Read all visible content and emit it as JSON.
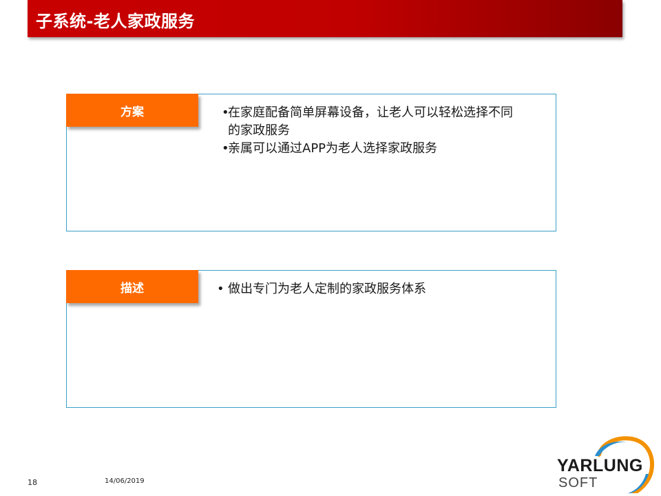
{
  "header": {
    "title": "子系统-老人家政服务"
  },
  "sections": [
    {
      "label": "方案",
      "bullets": [
        "在家庭配备简单屏幕设备，让老人可以轻松选择不同的家政服务",
        "亲属可以通过APP为老人选择家政服务"
      ]
    },
    {
      "label": "描述",
      "bullets": [
        "做出专门为老人定制的家政服务体系"
      ]
    }
  ],
  "footer": {
    "page_number": "18",
    "date": "14/06/2019",
    "logo_main": "YARLUNG",
    "logo_sub": "SOFT"
  },
  "colors": {
    "title_bar": "#c00000",
    "tab": "#ff6a00",
    "panel_border": "#3aa0c8",
    "logo_arc_orange": "#f39200",
    "logo_arc_blue": "#2a8fd0"
  }
}
